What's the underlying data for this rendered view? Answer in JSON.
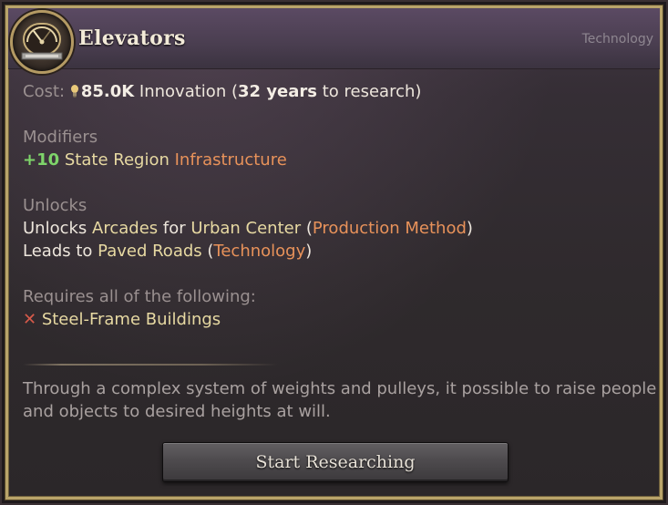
{
  "header": {
    "title": "Elevators",
    "category": "Technology",
    "icon": "elevator-gauge-icon"
  },
  "cost": {
    "label": "Cost:",
    "icon": "lightbulb-icon",
    "amount": "85.0K",
    "resource": "Innovation",
    "paren_open": "(",
    "duration": "32 years",
    "duration_suffix": "to research)"
  },
  "modifiers": {
    "heading": "Modifiers",
    "value": "+10",
    "scope": "State Region",
    "target": "Infrastructure"
  },
  "unlocks": {
    "heading": "Unlocks",
    "line1": {
      "prefix": "Unlocks",
      "item": "Arcades",
      "mid": "for",
      "building": "Urban Center",
      "paren_open": "(",
      "kind": "Production Method",
      "paren_close": ")"
    },
    "line2": {
      "prefix": "Leads to",
      "item": "Paved Roads",
      "paren_open": "(",
      "kind": "Technology",
      "paren_close": ")"
    }
  },
  "requires": {
    "heading": "Requires all of the following:",
    "icon": "red-x-icon",
    "item": "Steel-Frame Buildings"
  },
  "description": "Through a complex system of weights and pulleys, it possible to raise people and objects to desired heights at will.",
  "action": {
    "button_label": "Start Researching"
  },
  "colors": {
    "frame_gold": "#b9a46a",
    "positive_green": "#7ed46a",
    "highlight_yellow": "#e7d9a2",
    "link_orange": "#e8925a",
    "fail_red": "#d65a4a"
  }
}
